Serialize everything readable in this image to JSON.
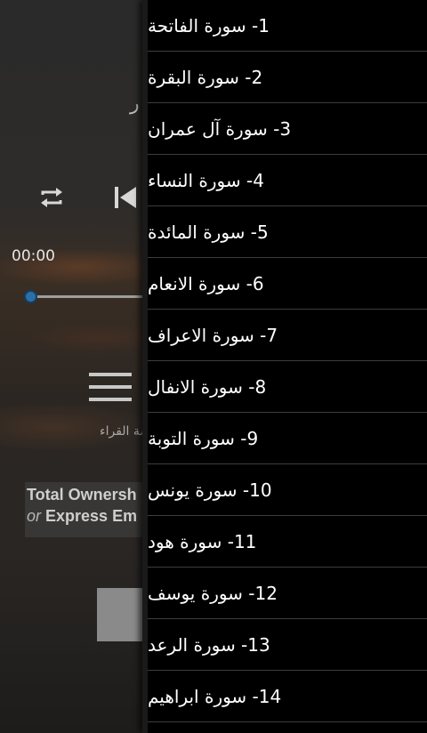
{
  "player": {
    "title_fragment": "ر",
    "time_start": "00:00",
    "seek_progress": 0.0,
    "reciters_label": "قائمة القراء",
    "ad": {
      "line1": "Total Ownersh",
      "line2_or": "or",
      "line2_text": " Express Em"
    },
    "accent_color": "#2c6fa8",
    "icons": [
      "repeat-icon",
      "skip-previous-icon",
      "menu-icon"
    ]
  },
  "drawer": {
    "surahs": [
      {
        "label": "1- سورة الفاتحة"
      },
      {
        "label": "2- سورة البقرة"
      },
      {
        "label": "3- سورة آل عمران"
      },
      {
        "label": "4- سورة النساء"
      },
      {
        "label": "5- سورة المائدة"
      },
      {
        "label": "6- سورة الانعام"
      },
      {
        "label": "7- سورة الاعراف"
      },
      {
        "label": "8- سورة الانفال"
      },
      {
        "label": "9- سورة التوبة"
      },
      {
        "label": "10- سورة يونس"
      },
      {
        "label": "11- سورة هود"
      },
      {
        "label": "12- سورة يوسف"
      },
      {
        "label": "13- سورة الرعد"
      },
      {
        "label": "14- سورة ابراهيم"
      }
    ]
  }
}
